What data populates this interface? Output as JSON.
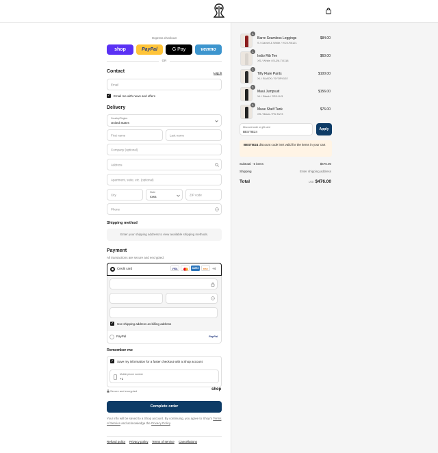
{
  "header": {
    "logo_name": "brand-logo",
    "cart_icon": "shopping-bag-icon"
  },
  "express": {
    "title": "Express checkout",
    "buttons": [
      {
        "label": "shop",
        "color": "#5a31f4"
      },
      {
        "label": "PayPal",
        "color": "#ffc439"
      },
      {
        "label": "G Pay",
        "color": "#000000"
      },
      {
        "label": "venmo",
        "color": "#3d95ce"
      }
    ],
    "or": "OR"
  },
  "contact": {
    "title": "Contact",
    "login": "Log in",
    "email_placeholder": "Email",
    "news_label": "Email me with news and offers"
  },
  "delivery": {
    "title": "Delivery",
    "country_label": "Country/Region",
    "country_value": "United States",
    "first_name": "First name",
    "last_name": "Last name",
    "company": "Company (optional)",
    "address": "Address",
    "apartment": "Apartment, suite, etc. (optional)",
    "city": "City",
    "state_label": "State",
    "state_value": "Iowa",
    "zip": "ZIP code",
    "phone": "Phone"
  },
  "shipping": {
    "title": "Shipping method",
    "message": "Enter your shipping address to view available shipping methods."
  },
  "payment": {
    "title": "Payment",
    "subtitle": "All transactions are secure and encrypted.",
    "credit_card": "Credit card",
    "cards": [
      "VISA",
      "MC",
      "AMEX",
      "DISC"
    ],
    "more_cards": "+4",
    "billing_label": "Use shipping address as billing address",
    "paypal": "PayPal",
    "paypal_logo": "PayPal"
  },
  "remember": {
    "title": "Remember me",
    "save_label": "Save my information for a faster checkout with a Shop account",
    "phone_label": "Mobile phone number",
    "phone_value": "+1",
    "secure": "Secure and encrypted",
    "shop_logo": "shop"
  },
  "complete_button": "Complete order",
  "legal": {
    "text1": "Your info will be saved to a Shop account. By continuing, you agree to Shop's",
    "tos": "Terms of Service",
    "mid": " and acknowledge the ",
    "privacy": "Privacy Policy",
    "end": "."
  },
  "footer": [
    "Refund policy",
    "Privacy policy",
    "Terms of service",
    "Cancellations"
  ],
  "cart": {
    "items": [
      {
        "qty": "1",
        "name": "Barre Seamless Leggings",
        "variant": "S / Garnet & White / HC9-PA121",
        "price": "$84.00",
        "color": "#8b1c1c"
      },
      {
        "qty": "1",
        "name": "Indio Rib Tee",
        "variant": "XS / White / EU26-TO118",
        "price": "$60.00",
        "color": "#d9d4ce"
      },
      {
        "qty": "1",
        "name": "Tilly Flare Pants",
        "variant": "XL / BLACK / SYOP4102",
        "price": "$100.00",
        "color": "#2a2a2a"
      },
      {
        "qty": "1",
        "name": "Maui Jumpsuit",
        "variant": "XL / Black / SS3-JU3",
        "price": "$156.00",
        "color": "#1f1f1f"
      },
      {
        "qty": "1",
        "name": "Muse Shelf Tank",
        "variant": "XS / Black / FB-TA73",
        "price": "$76.00",
        "color": "#222222"
      }
    ],
    "discount_label": "Discount code or gift card",
    "discount_value": "BESTIE24",
    "apply": "Apply",
    "error_code": "BESTIE24",
    "error_text": " discount code isn't valid for the items in your cart",
    "subtotal_label": "Subtotal · 5 items",
    "subtotal_value": "$476.00",
    "shipping_label": "Shipping",
    "shipping_value": "Enter shipping address",
    "total_label": "Total",
    "currency": "USD",
    "total_value": "$476.00"
  }
}
